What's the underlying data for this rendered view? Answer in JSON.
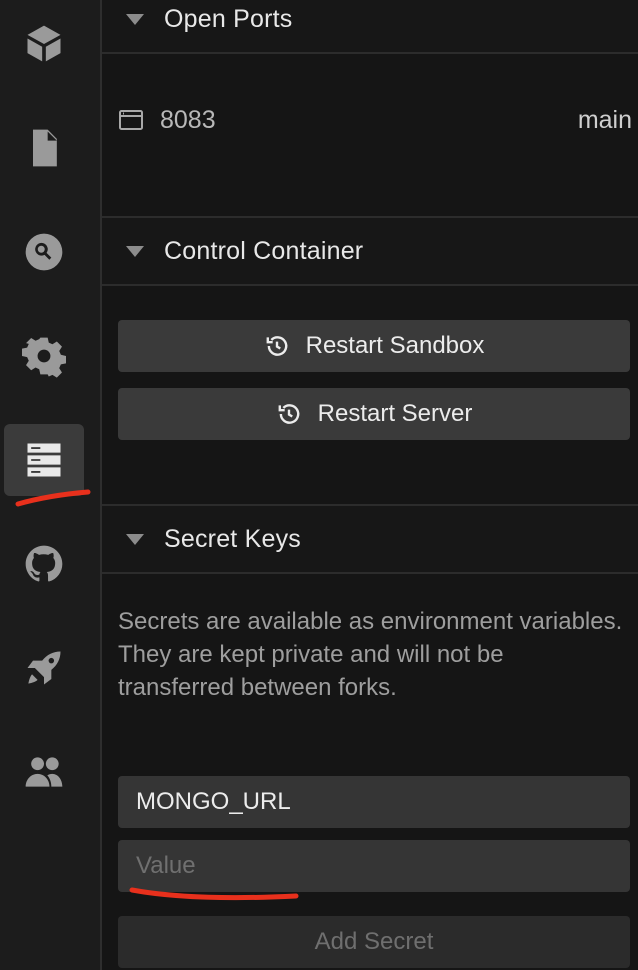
{
  "rail": {
    "items": [
      {
        "icon": "cube-icon",
        "active": false
      },
      {
        "icon": "file-icon",
        "active": false
      },
      {
        "icon": "search-icon",
        "active": false
      },
      {
        "icon": "gear-icon",
        "active": false
      },
      {
        "icon": "server-icon",
        "active": true
      },
      {
        "icon": "github-icon",
        "active": false
      },
      {
        "icon": "rocket-icon",
        "active": false
      },
      {
        "icon": "users-icon",
        "active": false
      }
    ]
  },
  "open_ports": {
    "title": "Open Ports",
    "ports": [
      {
        "port": "8083",
        "branch": "main"
      }
    ]
  },
  "control_container": {
    "title": "Control Container",
    "restart_sandbox_label": "Restart Sandbox",
    "restart_server_label": "Restart Server"
  },
  "secret_keys": {
    "title": "Secret Keys",
    "description": "Secrets are available as environment variables. They are kept private and will not be transferred between forks.",
    "name_value": "MONGO_URL",
    "value_placeholder": "Value",
    "add_label": "Add Secret"
  },
  "colors": {
    "annotation": "#e8301c",
    "active_rail": "#3b3b3b"
  }
}
